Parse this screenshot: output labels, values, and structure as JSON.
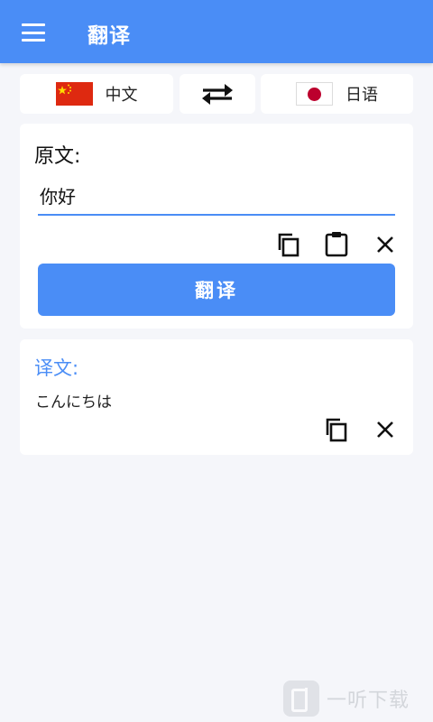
{
  "appbar": {
    "title": "翻译",
    "menu_icon": "hamburger-menu-icon",
    "color": "#4a8df6"
  },
  "languages": {
    "source": {
      "label": "中文",
      "flag": "china-flag-icon"
    },
    "swap_icon": "swap-arrows-icon",
    "target": {
      "label": "日语",
      "flag": "japan-flag-icon"
    }
  },
  "source_panel": {
    "heading": "原文:",
    "input_value": "你好",
    "icons": [
      "copy-icon",
      "paste-icon",
      "clear-icon"
    ],
    "translate_button": "翻译"
  },
  "result_panel": {
    "heading": "译文:",
    "text": "こんにちは",
    "icons": [
      "copy-icon",
      "clear-icon"
    ]
  },
  "watermark": {
    "text": "一听下载"
  }
}
